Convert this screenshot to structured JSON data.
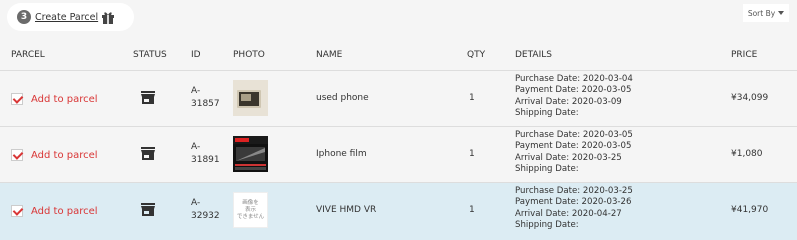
{
  "toolbar": {
    "parcel_count": "3",
    "create_parcel_label": "Create Parcel",
    "sort_label": "Sort By"
  },
  "table": {
    "headers": {
      "parcel": "PARCEL",
      "status": "STATUS",
      "id": "ID",
      "photo": "PHOTO",
      "name": "NAME",
      "qty": "QTY",
      "details": "DETAILS",
      "price": "PRICE"
    },
    "rows": [
      {
        "add_label": "Add to parcel",
        "id_prefix": "A-",
        "id_num": "31857",
        "name": "used phone",
        "qty": "1",
        "purchase": "Purchase Date: 2020-03-04",
        "payment": "Payment Date: 2020-03-05",
        "arrival": "Arrival Date: 2020-03-09",
        "shipping": "Shipping Date:",
        "price": "¥34,099"
      },
      {
        "add_label": "Add to parcel",
        "id_prefix": "A-",
        "id_num": "31891",
        "name": "Iphone film",
        "qty": "1",
        "purchase": "Purchase Date: 2020-03-05",
        "payment": "Payment Date: 2020-03-05",
        "arrival": "Arrival Date: 2020-03-25",
        "shipping": "Shipping Date:",
        "price": "¥1,080"
      },
      {
        "add_label": "Add to parcel",
        "id_prefix": "A-",
        "id_num": "32932",
        "name": "VIVE HMD VR",
        "qty": "1",
        "purchase": "Purchase Date: 2020-03-25",
        "payment": "Payment Date: 2020-03-26",
        "arrival": "Arrival Date: 2020-04-27",
        "shipping": "Shipping Date:",
        "price": "¥41,970",
        "photo_placeholder": [
          "画像を",
          "表示",
          "できません"
        ]
      }
    ]
  },
  "colors": {
    "accent_red": "#d93636",
    "selected_row": "#dcecf3"
  }
}
